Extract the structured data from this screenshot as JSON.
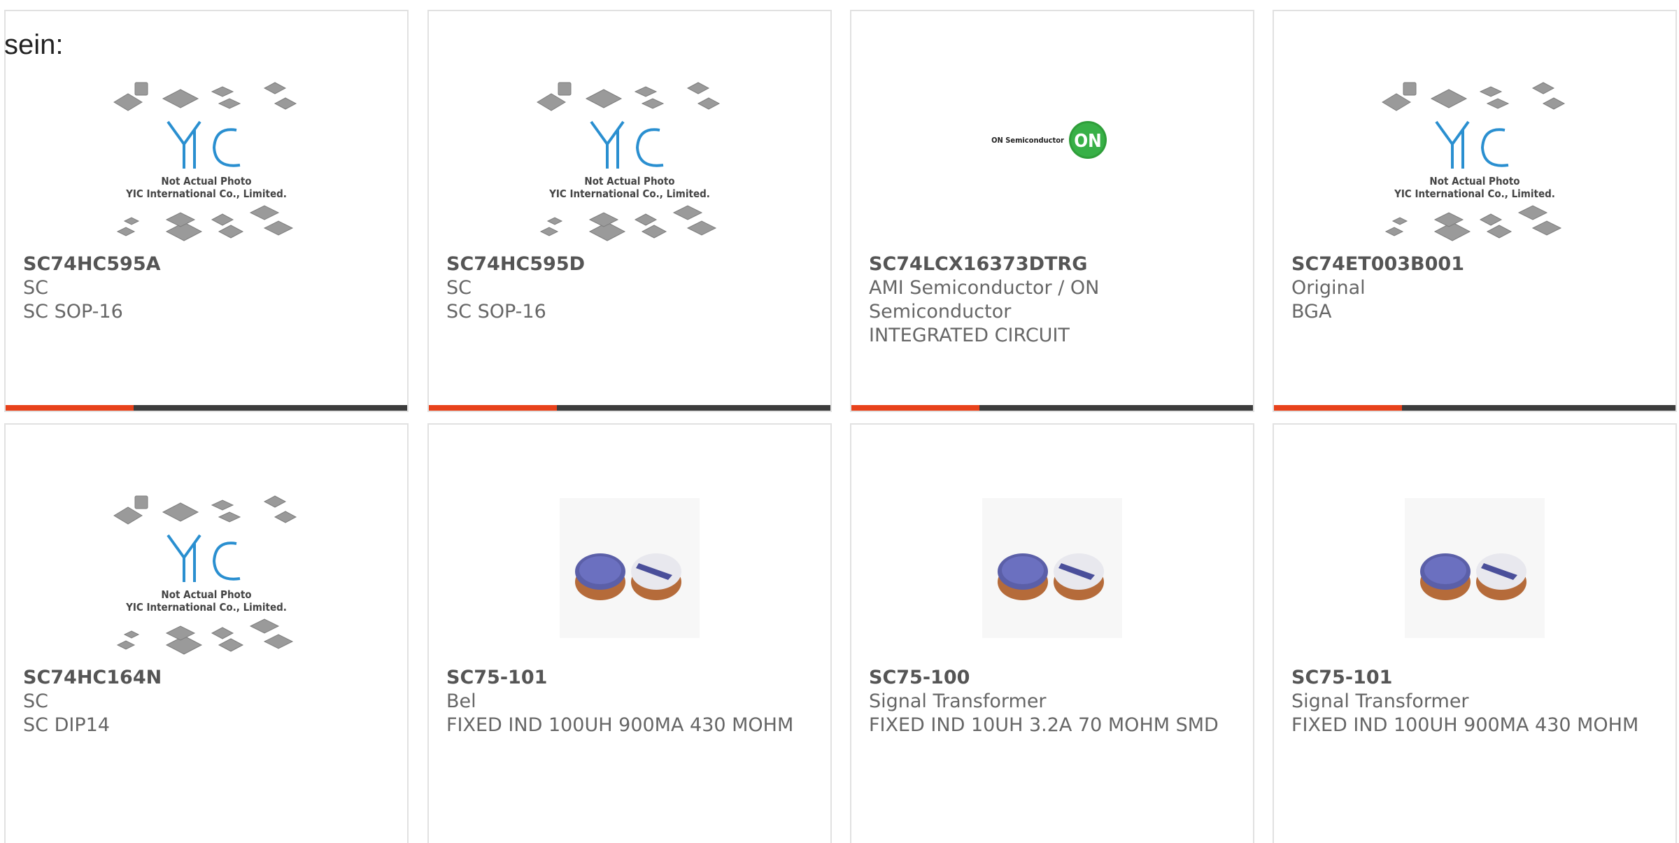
{
  "prefix_text": "sein:",
  "placeholder": {
    "line1": "Not Actual Photo",
    "line2": "YIC International Co., Limited.",
    "logo": "YIC"
  },
  "brand": {
    "on_text": "ON Semiconductor",
    "on_badge": "ON"
  },
  "colors": {
    "accent": "#e8421b",
    "bar": "#3c3c3c",
    "logo_blue": "#2a8fd0",
    "on_green": "#2f9e3a"
  },
  "products": [
    {
      "part": "SC74HC595A",
      "maker": "SC",
      "desc": "SC SOP-16",
      "image": "yic-placeholder"
    },
    {
      "part": "SC74HC595D",
      "maker": "SC",
      "desc": "SC SOP-16",
      "image": "yic-placeholder"
    },
    {
      "part": "SC74LCX16373DTRG",
      "maker": "AMI Semiconductor / ON Semiconductor",
      "desc": "INTEGRATED CIRCUIT",
      "image": "on-semiconductor-logo"
    },
    {
      "part": "SC74ET003B001",
      "maker": "Original",
      "desc": "BGA",
      "image": "yic-placeholder"
    },
    {
      "part": "SC74HC164N",
      "maker": "SC",
      "desc": "SC DIP14",
      "image": "yic-placeholder"
    },
    {
      "part": "SC75-101",
      "maker": "Bel",
      "desc": "FIXED IND 100UH 900MA 430 MOHM",
      "image": "inductor-photo"
    },
    {
      "part": "SC75-100",
      "maker": "Signal Transformer",
      "desc": "FIXED IND 10UH 3.2A 70 MOHM SMD",
      "image": "inductor-photo"
    },
    {
      "part": "SC75-101",
      "maker": "Signal Transformer",
      "desc": "FIXED IND 100UH 900MA 430 MOHM",
      "image": "inductor-photo"
    }
  ]
}
